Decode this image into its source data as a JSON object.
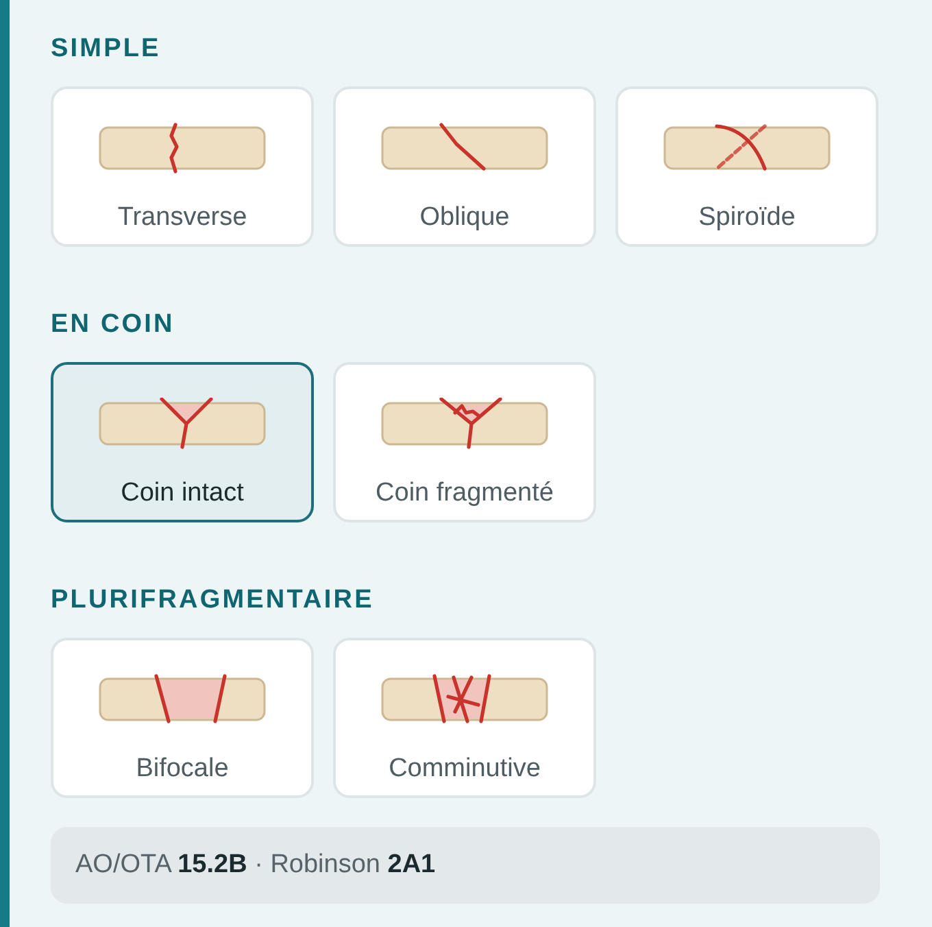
{
  "sections": [
    {
      "title": "SIMPLE",
      "options": [
        {
          "label": "Transverse",
          "kind": "transverse",
          "selected": false
        },
        {
          "label": "Oblique",
          "kind": "oblique",
          "selected": false
        },
        {
          "label": "Spiroïde",
          "kind": "spiral",
          "selected": false
        }
      ]
    },
    {
      "title": "EN COIN",
      "options": [
        {
          "label": "Coin intact",
          "kind": "wedge",
          "selected": true
        },
        {
          "label": "Coin fragmenté",
          "kind": "wedge_fragmented",
          "selected": false
        }
      ]
    },
    {
      "title": "PLURIFRAGMENTAIRE",
      "options": [
        {
          "label": "Bifocale",
          "kind": "bifocal",
          "selected": false
        },
        {
          "label": "Comminutive",
          "kind": "comminuted",
          "selected": false
        }
      ]
    }
  ],
  "classification": "AO/OTA **15.2B** · Robinson **2A1**"
}
